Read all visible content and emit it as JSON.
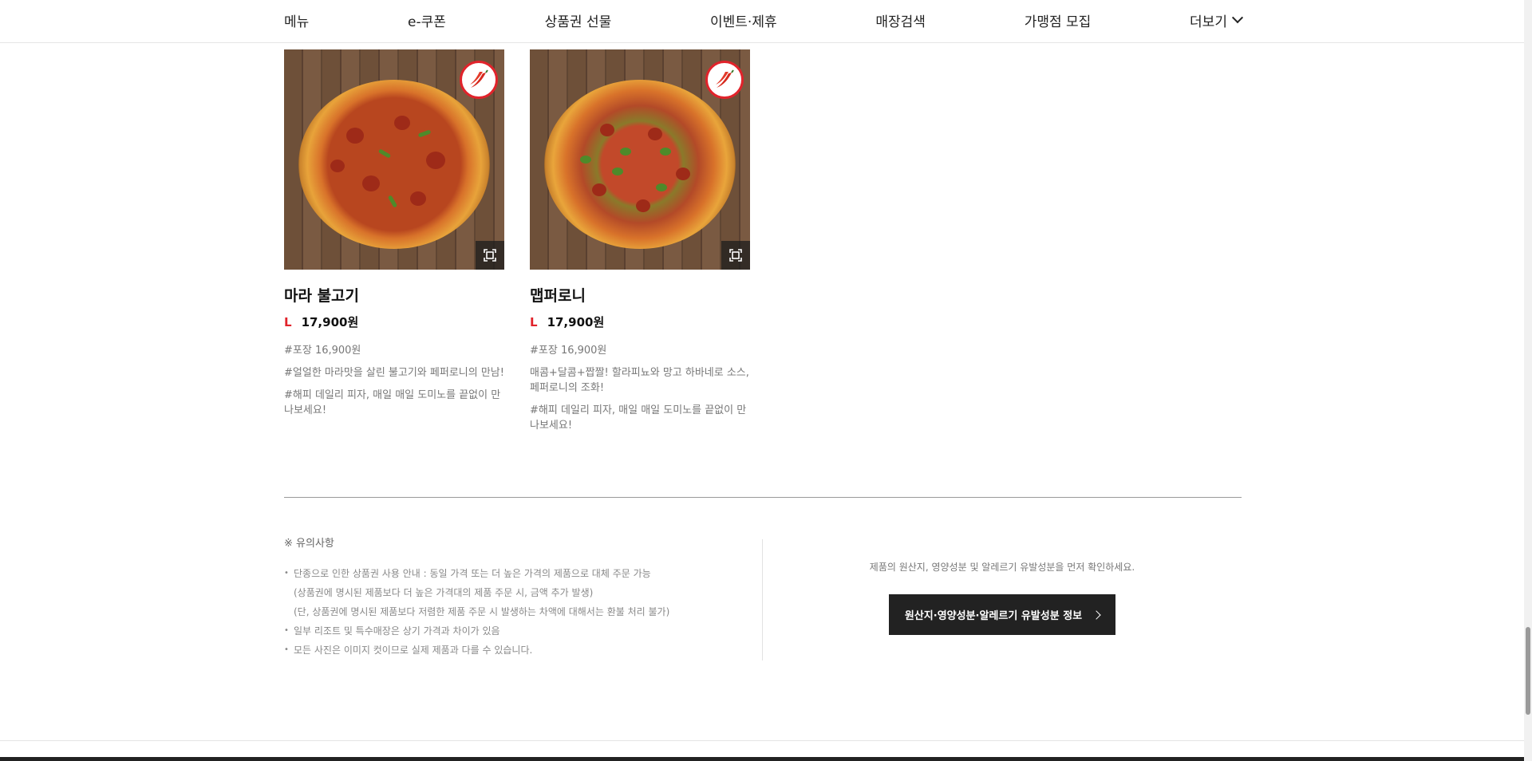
{
  "nav": {
    "items": [
      "메뉴",
      "e-쿠폰",
      "상품권 선물",
      "이벤트·제휴",
      "매장검색",
      "가맹점 모집"
    ],
    "more_label": "더보기"
  },
  "products": [
    {
      "name": "마라 불고기",
      "size": "L",
      "price": "17,900원",
      "tags": [
        "#포장 16,900원",
        "#얼얼한 마라맛을 살린 불고기와 페퍼로니의 만남!",
        "#해피 데일리 피자, 매일 매일 도미노를 끝없이 만나보세요!"
      ],
      "spicy_icon": "chili-pepper-icon",
      "zoom_icon": "expand-icon"
    },
    {
      "name": "맵퍼로니",
      "size": "L",
      "price": "17,900원",
      "tags": [
        "#포장 16,900원",
        "매콤+달콤+짭짤! 할라피뇨와 망고 하바네로 소스, 페퍼로니의 조화!",
        "#해피 데일리 피자, 매일 매일 도미노를 끝없이 만나보세요!"
      ],
      "spicy_icon": "chili-pepper-icon",
      "zoom_icon": "expand-icon"
    }
  ],
  "notice": {
    "title": "※ 유의사항",
    "items": [
      {
        "text": "단종으로 인한 상품권 사용 안내 : 동일 가격 또는 더 높은 가격의 제품으로 대체 주문 가능",
        "sub": [
          "(상품권에 명시된 제품보다 더 높은 가격대의 제품 주문 시, 금액 추가 발생)",
          "(단, 상품권에 명시된 제품보다 저렴한 제품 주문 시 발생하는 차액에 대해서는 환불 처리 불가)"
        ]
      },
      {
        "text": "일부 리조트 및 특수매장은 상기 가격과 차이가 있음",
        "sub": []
      },
      {
        "text": "모든 사진은 이미지 컷이므로 실제 제품과 다를 수 있습니다.",
        "sub": []
      }
    ]
  },
  "origin": {
    "text": "제품의 원산지, 영양성분 및 알레르기 유발성분을 먼저 확인하세요.",
    "button_label": "원산지·영양성분·알레르기 유발성분 정보"
  },
  "colors": {
    "accent": "#e1232b",
    "dark_button": "#222222"
  }
}
